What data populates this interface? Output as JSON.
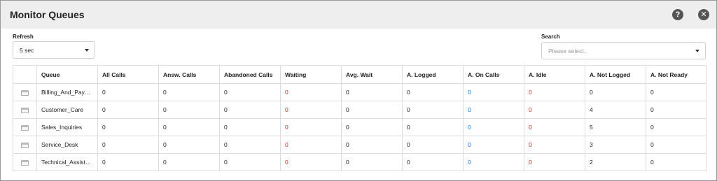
{
  "window": {
    "title": "Monitor Queues",
    "help_icon": "?",
    "close_icon": "✕"
  },
  "refresh": {
    "label": "Refresh",
    "value": "5 sec"
  },
  "search": {
    "label": "Search",
    "placeholder": "Please select.."
  },
  "table": {
    "columns": [
      "",
      "Queue",
      "All Calls",
      "Answ. Calls",
      "Abandoned Calls",
      "Waiting",
      "Avg. Wait",
      "A. Logged",
      "A. On Calls",
      "A. Idle",
      "A. Not Logged",
      "A. Not Ready"
    ],
    "rows": [
      {
        "queue": "Billing_And_Paym...",
        "all_calls": "0",
        "answ_calls": "0",
        "abandoned_calls": "0",
        "waiting": "0",
        "avg_wait": "0",
        "a_logged": "0",
        "a_on_calls": "0",
        "a_idle": "0",
        "a_not_logged": "0",
        "a_not_ready": "0"
      },
      {
        "queue": "Customer_Care",
        "all_calls": "0",
        "answ_calls": "0",
        "abandoned_calls": "0",
        "waiting": "0",
        "avg_wait": "0",
        "a_logged": "0",
        "a_on_calls": "0",
        "a_idle": "0",
        "a_not_logged": "4",
        "a_not_ready": "0"
      },
      {
        "queue": "Sales_Inquiries",
        "all_calls": "0",
        "answ_calls": "0",
        "abandoned_calls": "0",
        "waiting": "0",
        "avg_wait": "0",
        "a_logged": "0",
        "a_on_calls": "0",
        "a_idle": "0",
        "a_not_logged": "5",
        "a_not_ready": "0"
      },
      {
        "queue": "Service_Desk",
        "all_calls": "0",
        "answ_calls": "0",
        "abandoned_calls": "0",
        "waiting": "0",
        "avg_wait": "0",
        "a_logged": "0",
        "a_on_calls": "0",
        "a_idle": "0",
        "a_not_logged": "3",
        "a_not_ready": "0"
      },
      {
        "queue": "Technical_Assista...",
        "all_calls": "0",
        "answ_calls": "0",
        "abandoned_calls": "0",
        "waiting": "0",
        "avg_wait": "0",
        "a_logged": "0",
        "a_on_calls": "0",
        "a_idle": "0",
        "a_not_logged": "2",
        "a_not_ready": "0"
      }
    ]
  },
  "colors": {
    "waiting": "#e02020",
    "on_calls": "#1a6fc4",
    "idle": "#e02020",
    "titlebar": "#eeeeee"
  },
  "icons": {
    "row": "queue-row-icon",
    "help": "help-icon",
    "close": "close-icon",
    "caret": "chevron-down-icon"
  }
}
